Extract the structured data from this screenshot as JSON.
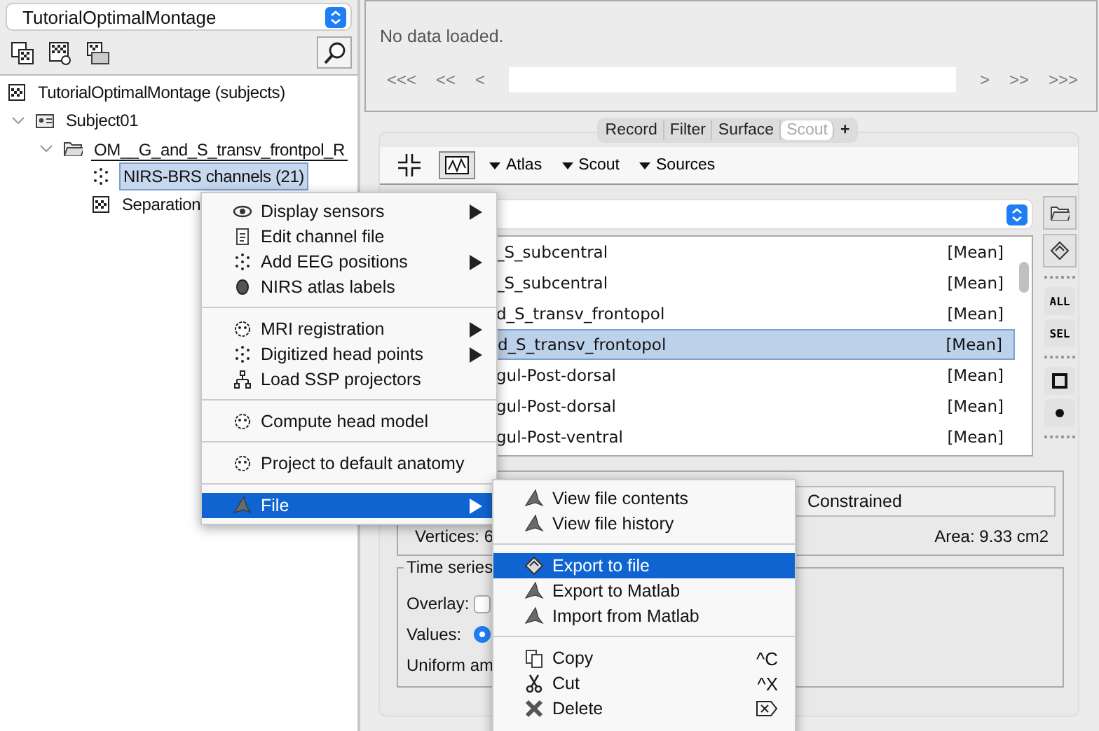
{
  "left_panel": {
    "protocol_dropdown": {
      "value": "TutorialOptimalMontage"
    },
    "tree": [
      {
        "label": "TutorialOptimalMontage (subjects)",
        "selected": false,
        "children": [
          {
            "label": "Subject01",
            "expanded": true,
            "selected": false,
            "children": [
              {
                "label": "OM__G_and_S_transv_frontpol_R",
                "expanded": true,
                "selected": false,
                "children": [
                  {
                    "label": "NIRS-BRS channels (21)",
                    "selected": true
                  },
                  {
                    "label": "Separation",
                    "selected": false
                  }
                ]
              }
            ]
          }
        ]
      }
    ]
  },
  "viewer": {
    "message": "No data loaded.",
    "nav_left": [
      "<<<",
      "<<",
      "<"
    ],
    "nav_right": [
      ">",
      ">>",
      ">>>"
    ]
  },
  "tabs": [
    {
      "label": "Record",
      "selected": false
    },
    {
      "label": "Filter",
      "selected": false
    },
    {
      "label": "Surface",
      "selected": false
    },
    {
      "label": "Scout",
      "selected": true
    }
  ],
  "add_tab": "+",
  "toolbar": {
    "menus": [
      "Atlas",
      "Scout",
      "Sources"
    ]
  },
  "scout_list": {
    "rows": [
      {
        "name": "_S_subcentral",
        "function": "[Mean]",
        "selected": false
      },
      {
        "name": "_S_subcentral",
        "function": "[Mean]",
        "selected": false
      },
      {
        "name": "d_S_transv_frontopol",
        "function": "[Mean]",
        "selected": false
      },
      {
        "name": "d_S_transv_frontopol",
        "function": "[Mean]",
        "selected": true
      },
      {
        "name": "gul-Post-dorsal",
        "function": "[Mean]",
        "selected": false
      },
      {
        "name": "gul-Post-dorsal",
        "function": "[Mean]",
        "selected": false
      },
      {
        "name": "gul-Post-ventral",
        "function": "[Mean]",
        "selected": false
      }
    ],
    "side_buttons": [
      "ALL",
      "SEL"
    ]
  },
  "scout_size": {
    "field": "Constrained",
    "vertices": "Vertices: 6",
    "area": "Area: 9.33 cm2"
  },
  "time_series": {
    "title": "Time series",
    "overlay_label": "Overlay:",
    "overlay_checked": false,
    "values_label": "Values:",
    "values_radio_checked": true,
    "uniform_label": "Uniform am"
  },
  "context_menu": [
    {
      "kind": "item",
      "label": "Display sensors",
      "submenu": true,
      "selected": false
    },
    {
      "kind": "item",
      "label": "Edit channel file",
      "submenu": false,
      "selected": false
    },
    {
      "kind": "item",
      "label": "Add EEG positions",
      "submenu": true,
      "selected": false
    },
    {
      "kind": "item",
      "label": "NIRS atlas labels",
      "submenu": false,
      "selected": false
    },
    {
      "kind": "separator"
    },
    {
      "kind": "item",
      "label": "MRI registration",
      "submenu": true,
      "selected": false
    },
    {
      "kind": "item",
      "label": "Digitized head points",
      "submenu": true,
      "selected": false
    },
    {
      "kind": "item",
      "label": "Load SSP projectors",
      "submenu": false,
      "selected": false
    },
    {
      "kind": "separator"
    },
    {
      "kind": "item",
      "label": "Compute head model",
      "submenu": false,
      "selected": false
    },
    {
      "kind": "separator"
    },
    {
      "kind": "item",
      "label": "Project to default anatomy",
      "submenu": false,
      "selected": false
    },
    {
      "kind": "separator"
    },
    {
      "kind": "item",
      "label": "File",
      "submenu": true,
      "selected": true
    }
  ],
  "file_submenu": [
    {
      "kind": "item",
      "label": "View file contents",
      "selected": false
    },
    {
      "kind": "item",
      "label": "View file history",
      "selected": false
    },
    {
      "kind": "separator"
    },
    {
      "kind": "item",
      "label": "Export to file",
      "selected": true
    },
    {
      "kind": "item",
      "label": "Export to Matlab",
      "selected": false
    },
    {
      "kind": "item",
      "label": "Import from Matlab",
      "selected": false
    },
    {
      "kind": "separator"
    },
    {
      "kind": "item",
      "label": "Copy",
      "selected": false,
      "shortcut": "^C"
    },
    {
      "kind": "item",
      "label": "Cut",
      "selected": false,
      "shortcut": "^X"
    },
    {
      "kind": "item_key_icon",
      "label": "Delete",
      "selected": false
    }
  ]
}
